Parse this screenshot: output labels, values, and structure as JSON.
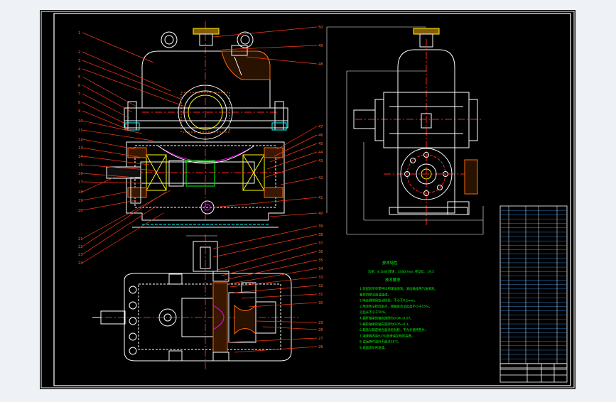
{
  "colors": {
    "page_bg": "#eef1f5",
    "sheet": "#000000",
    "frame": "#ffffff",
    "outline": "#ffffff",
    "leader": "#ff3b1a",
    "center": "#ff2020",
    "green": "#00ff00",
    "cyan": "#00ffff",
    "magenta": "#ff00ff",
    "yellow": "#ffff00",
    "blue": "#3070ff",
    "hatch": "#ff6a00",
    "table": "#3da5ff"
  },
  "balloons_left": [
    "1",
    "2",
    "3",
    "4",
    "5",
    "6",
    "7",
    "8",
    "9",
    "10",
    "11",
    "12",
    "13",
    "14",
    "15",
    "16",
    "17",
    "18",
    "19",
    "20",
    "21",
    "22",
    "23",
    "24"
  ],
  "balloons_right": [
    "50",
    "49",
    "48",
    "47",
    "46",
    "45",
    "44",
    "43",
    "42",
    "41",
    "40"
  ],
  "balloons_plan": [
    "39",
    "38",
    "37",
    "36",
    "35",
    "34",
    "33",
    "32",
    "31",
    "30",
    "29",
    "28",
    "27",
    "26"
  ],
  "notes": {
    "title": "技术特性",
    "spec": "功率：4.1kW   转速：1440r/min   传动比：19.5",
    "req_title": "技术要求",
    "lines": [
      "1.装配前所有零件均用煤油清洗，滚动轴承用汽油清洗。",
      "  箱体内壁涂耐油油漆。",
      "2.啮合侧隙用铅丝检验，不小于0.1mm。",
      "3.用涂色法检验斑点，接触斑点沿齿高不小于55%，",
      "  沿齿长不小于50%。",
      "4.蜗杆轴承的轴向游隙为0.04~0.07。",
      "5.蜗轮轴承的轴向游隙为0.05~0.1。",
      "6.箱盖与箱座接合面涂密封胶，不允许使用垫片。",
      "7.减速器内装HJ-50润滑油至规定高度。",
      "8.试运转时温升不超过35℃。",
      "9.表面涂灰色油漆。"
    ]
  }
}
